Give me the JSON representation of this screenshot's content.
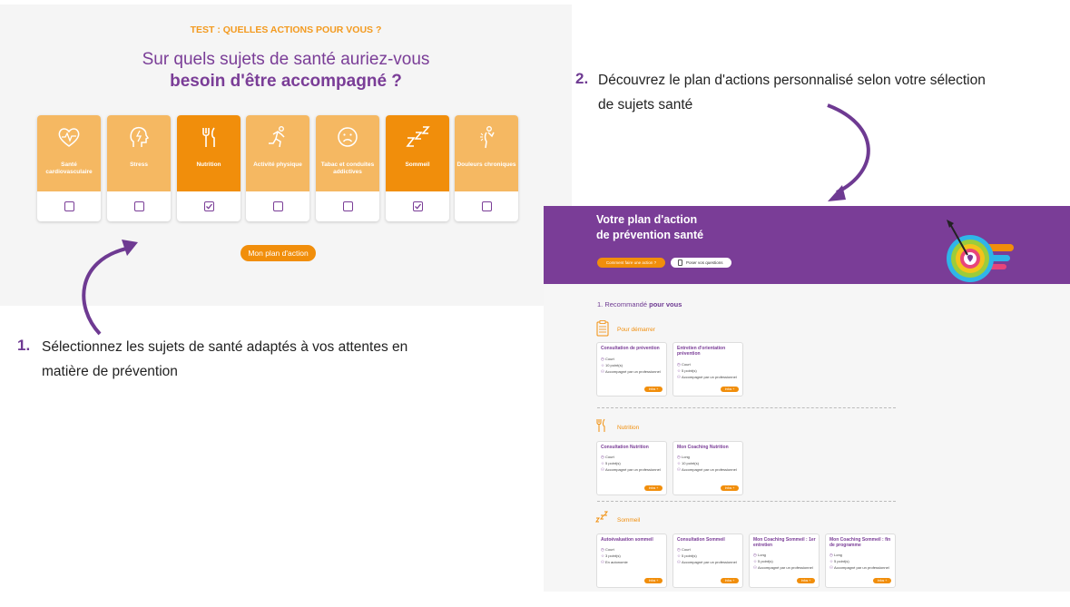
{
  "test": {
    "kicker": "TEST : QUELLES ACTIONS POUR VOUS ?",
    "question_line1": "Sur quels sujets de santé auriez-vous",
    "question_line2": "besoin d'être accompagné ?",
    "cards": [
      {
        "label": "Santé cardiovasculaire",
        "icon": "heart-pulse-icon",
        "checked": false
      },
      {
        "label": "Stress",
        "icon": "head-lightning-icon",
        "checked": false
      },
      {
        "label": "Nutrition",
        "icon": "fork-knife-icon",
        "checked": true
      },
      {
        "label": "Activité physique",
        "icon": "runner-icon",
        "checked": false
      },
      {
        "label": "Tabac et conduites addictives",
        "icon": "sad-face-icon",
        "checked": false
      },
      {
        "label": "Sommeil",
        "icon": "zzz-icon",
        "checked": true
      },
      {
        "label": "Douleurs chroniques",
        "icon": "body-pain-icon",
        "checked": false
      }
    ],
    "cta": "Mon plan d'action"
  },
  "captions": {
    "step1_num": "1.",
    "step1_line1": "Sélectionnez les sujets de santé adaptés à vos attentes en",
    "step1_line2": "matière de prévention",
    "step2_num": "2.",
    "step2_line1": "Découvrez le plan d'actions personnalisé selon votre sélection",
    "step2_line2": "de sujets santé"
  },
  "plan": {
    "title_line1": "Votre plan d'action",
    "title_line2": "de prévention santé",
    "btn_how": "Comment faire une action ?",
    "btn_ask": "Poser vos questions",
    "reco_prefix": "1. Recommandé",
    "reco_bold": "pour vous",
    "sections": [
      {
        "title": "Pour démarrer",
        "icon": "checklist-icon",
        "cards": [
          {
            "title": "Consultation de prévention",
            "duration": "Court",
            "points": "10 point(s)",
            "mode": "Accompagné par un professionnel"
          },
          {
            "title": "Entretien d'orientation prévention",
            "duration": "Court",
            "points": "5 point(s)",
            "mode": "Accompagné par un professionnel"
          }
        ]
      },
      {
        "title": "Nutrition",
        "icon": "fork-knife-icon",
        "cards": [
          {
            "title": "Consultation Nutrition",
            "duration": "Court",
            "points": "5 point(s)",
            "mode": "Accompagné par un professionnel"
          },
          {
            "title": "Mon Coaching Nutrition",
            "duration": "Long",
            "points": "10 point(s)",
            "mode": "Accompagné par un professionnel"
          }
        ]
      },
      {
        "title": "Sommeil",
        "icon": "zzz-icon",
        "cards": [
          {
            "title": "Autoévaluation sommeil",
            "duration": "Court",
            "points": "3 point(s)",
            "mode": "En autonomie"
          },
          {
            "title": "Consultation Sommeil",
            "duration": "Court",
            "points": "5 point(s)",
            "mode": "Accompagné par un professionnel"
          },
          {
            "title": "Mon Coaching Sommeil : 1er entretien",
            "duration": "Long",
            "points": "5 point(s)",
            "mode": "Accompagné par un professionnel"
          },
          {
            "title": "Mon Coaching Sommeil : fin de programme",
            "duration": "Long",
            "points": "5 point(s)",
            "mode": "Accompagné par un professionnel"
          }
        ]
      }
    ],
    "info_label": "Infos +"
  },
  "colors": {
    "purple": "#7a3d97",
    "orange": "#f18e0b",
    "orange_light": "#f5b862"
  }
}
